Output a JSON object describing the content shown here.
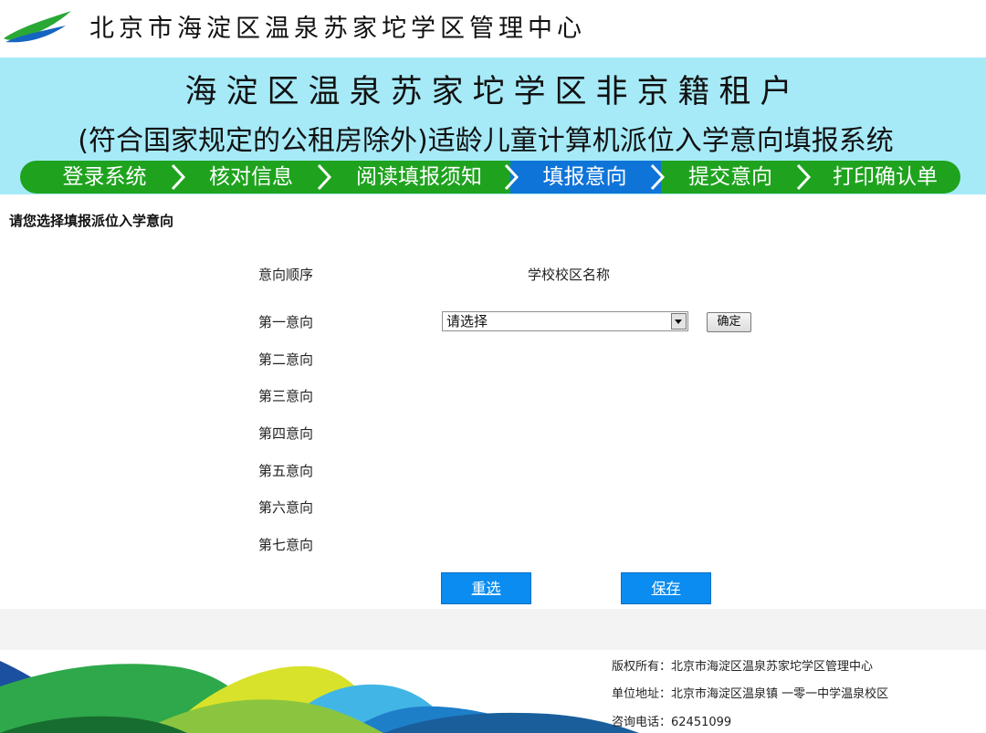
{
  "header": {
    "org_name": "北京市海淀区温泉苏家坨学区管理中心",
    "logo_icon": "leaf-logo-icon"
  },
  "banner": {
    "title_line1": "海淀区温泉苏家坨学区非京籍租户",
    "title_line2": "(符合国家规定的公租房除外)适龄儿童计算机派位入学意向填报系统"
  },
  "steps": [
    {
      "label": "登录系统",
      "active": false
    },
    {
      "label": "核对信息",
      "active": false
    },
    {
      "label": "阅读填报须知",
      "active": false
    },
    {
      "label": "填报意向",
      "active": true
    },
    {
      "label": "提交意向",
      "active": false
    },
    {
      "label": "打印确认单",
      "active": false
    }
  ],
  "main": {
    "prompt": "请您选择填报派位入学意向",
    "col_order": "意向顺序",
    "col_school": "学校校区名称",
    "preferences": [
      "第一意向",
      "第二意向",
      "第三意向",
      "第四意向",
      "第五意向",
      "第六意向",
      "第七意向"
    ],
    "school_select_value": "请选择",
    "confirm_label": "确定",
    "reset_label": "重选",
    "save_label": "保存"
  },
  "footer": {
    "copyright": "版权所有：北京市海淀区温泉苏家坨学区管理中心",
    "address": "单位地址：北京市海淀区温泉镇 一零一中学温泉校区",
    "phone": "咨询电话：62451099"
  },
  "colors": {
    "banner_bg": "#a6eaf8",
    "stepbar_green": "#1fa31f",
    "active_step_blue": "#0f74d8",
    "button_blue": "#0a8cf0"
  }
}
